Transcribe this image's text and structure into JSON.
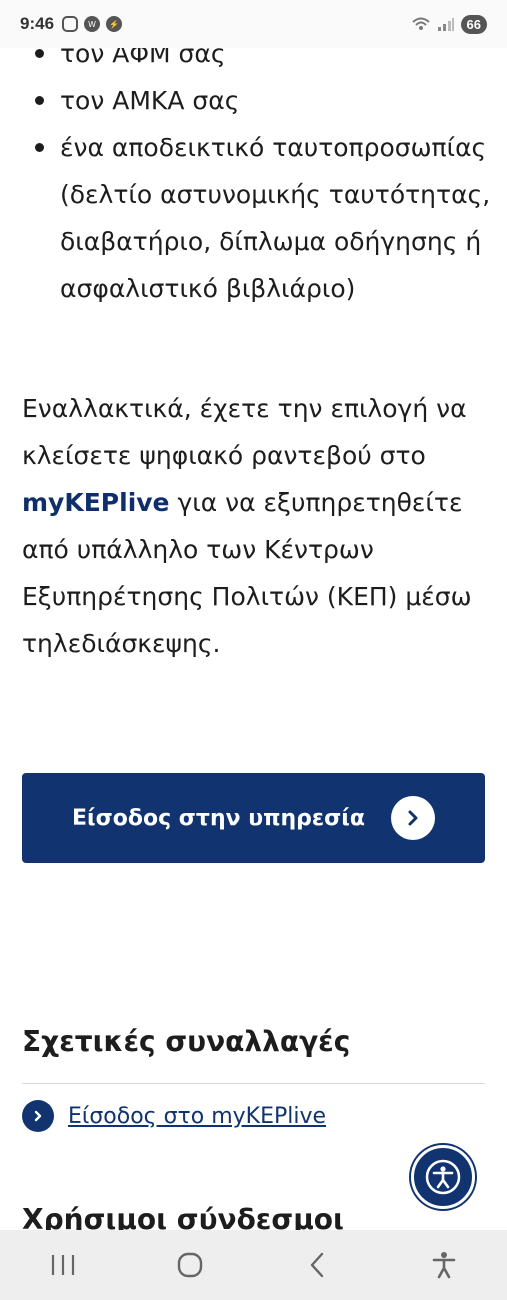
{
  "status_bar": {
    "time": "9:46",
    "battery": "66",
    "icons": [
      "screenshot-icon",
      "wear-icon",
      "bolt-icon",
      "wifi-icon",
      "signal-icon"
    ]
  },
  "bullets": [
    "τον ΑΦΜ σας",
    "τον ΑΜΚΑ σας",
    "ένα αποδεικτικό ταυτοπροσωπίας (δελτίο αστυνομικής ταυτότητας, διαβατήριο, δίπλωμα οδήγησης ή ασφαλιστικό βιβλιάριο)"
  ],
  "paragraph": {
    "before": "Εναλλακτικά, έχετε την επιλογή να κλείσετε ψηφιακό ραντεβού στο ",
    "link": "myKEPlive",
    "after": " για να εξυπηρετηθείτε από υπάλληλο των Κέντρων Εξυπηρέτησης Πολιτών (ΚΕΠ) μέσω τηλεδιάσκεψης."
  },
  "main_button": {
    "label": "Είσοδος στην υπηρεσία"
  },
  "related": {
    "title": "Σχετικές συναλλαγές",
    "items": [
      {
        "label": "Είσοδος στο myKEPlive"
      }
    ]
  },
  "useful_links": {
    "title": "Χρήσιμοι σύνδεσμοι"
  },
  "colors": {
    "brand": "#113471",
    "text": "#1d1d1d",
    "nav_bar": "#eeeeef"
  }
}
